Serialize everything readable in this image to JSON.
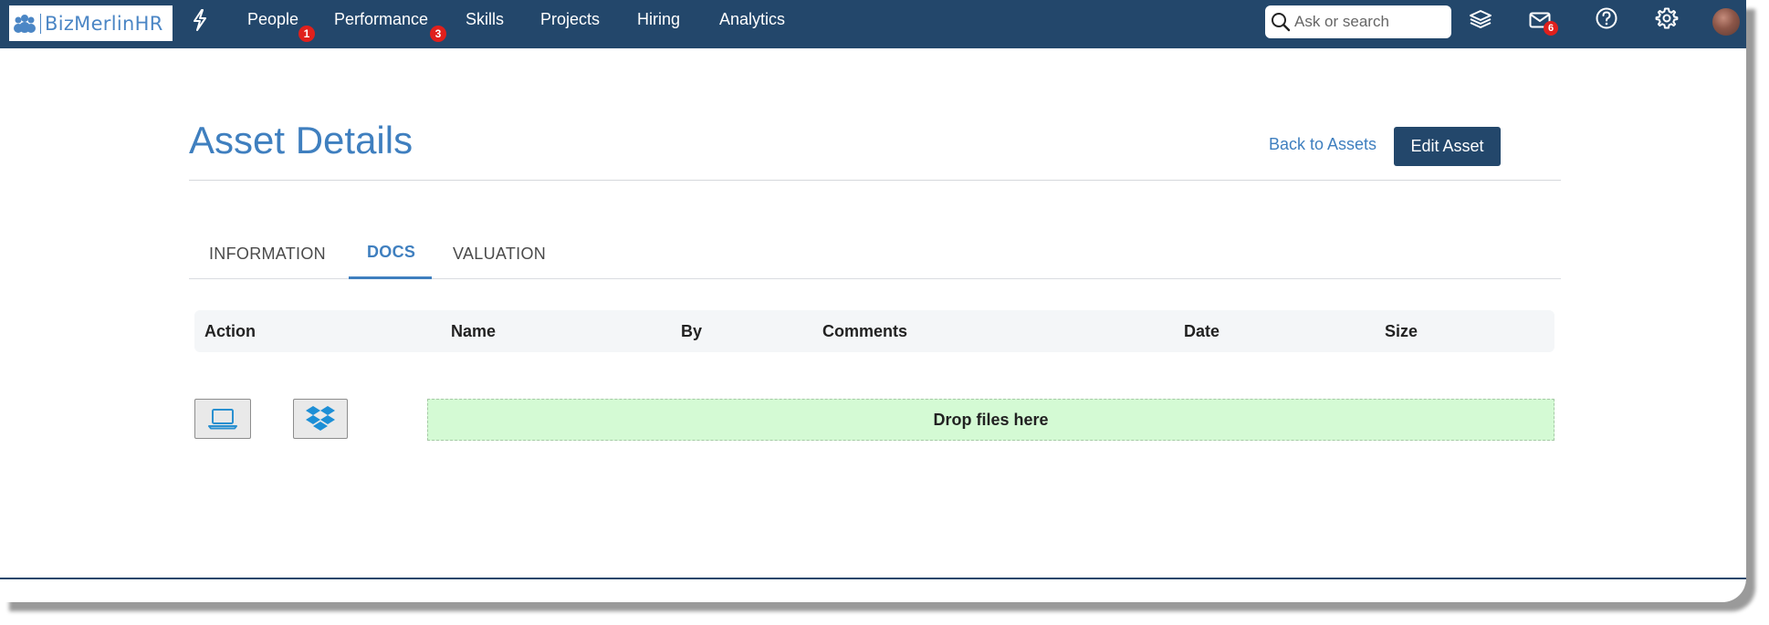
{
  "app": {
    "logo_text": "BizMerlinHR",
    "brand_color": "#23476b",
    "accent_color": "#3f7fbf"
  },
  "nav": {
    "quick_icon": "bolt-icon",
    "items": [
      {
        "label": "People",
        "badge": "1"
      },
      {
        "label": "Performance",
        "badge": "3"
      },
      {
        "label": "Skills",
        "badge": ""
      },
      {
        "label": "Projects",
        "badge": ""
      },
      {
        "label": "Hiring",
        "badge": ""
      },
      {
        "label": "Analytics",
        "badge": ""
      }
    ],
    "search_placeholder": "Ask or search",
    "mail_badge": "6",
    "icons": [
      "layers-icon",
      "mail-icon",
      "help-icon",
      "gear-icon",
      "avatar"
    ]
  },
  "header": {
    "title": "Asset Details",
    "back_label": "Back to Assets",
    "edit_label": "Edit Asset"
  },
  "tabs": {
    "items": [
      "INFORMATION",
      "DOCS",
      "VALUATION"
    ],
    "active": "DOCS"
  },
  "docs_table": {
    "columns": [
      "Action",
      "Name",
      "By",
      "Comments",
      "Date",
      "Size"
    ],
    "rows": []
  },
  "upload": {
    "computer_icon": "laptop-icon",
    "dropbox_icon": "dropbox-icon",
    "dropzone_label": "Drop files here",
    "dropzone_color": "#d4fad4"
  }
}
